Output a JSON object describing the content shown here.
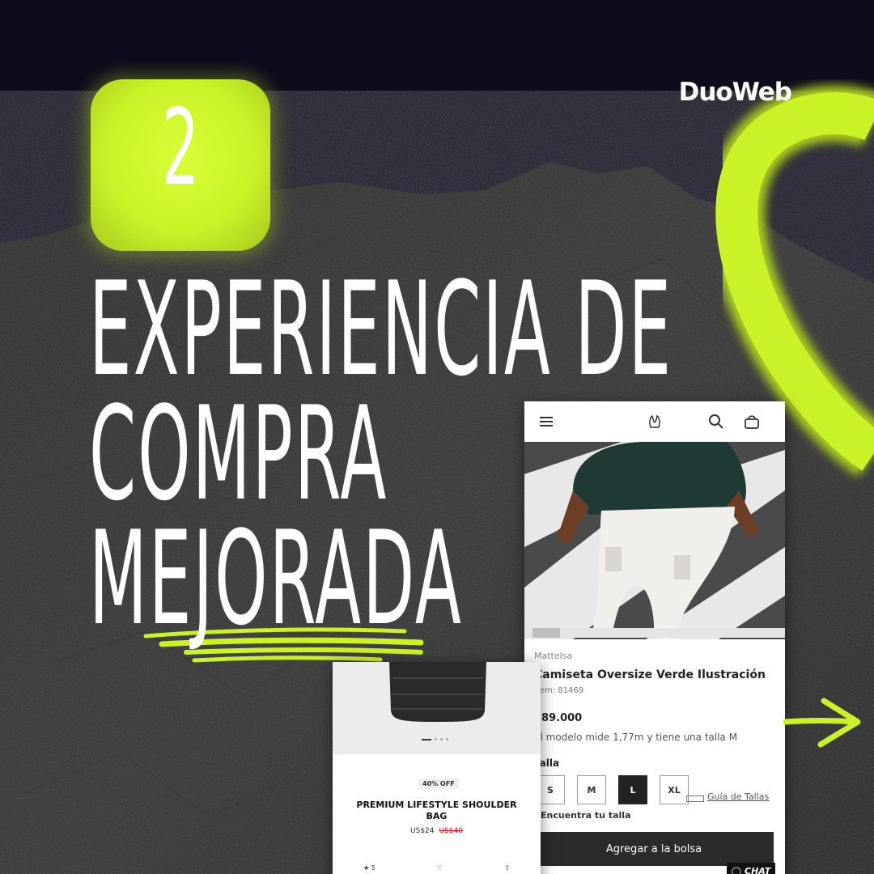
{
  "brand": "DuoWeb",
  "badge_number": "2",
  "headline": {
    "line1": "EXPERIENCIA DE",
    "line2": "COMPRA",
    "line3": "MEJORADA"
  },
  "colors": {
    "background": "#0d0b1c",
    "accent": "#c9f227",
    "text": "#ffffff"
  },
  "product_page": {
    "icons": [
      "menu-icon",
      "logo-icon",
      "search-icon",
      "cart-icon"
    ],
    "vendor": "Mattelsa",
    "name": "Camiseta Oversize Verde Ilustración",
    "item": "Item: 81469",
    "price": "$89.000",
    "model_note": "El modelo mide 1,77m y tiene una talla M",
    "size_label": "Talla",
    "sizes": [
      "S",
      "M",
      "L",
      "XL"
    ],
    "selected_size": "L",
    "size_guide": "Guía de Tallas",
    "find_size": "Encuentra tu talla",
    "add_to_bag": "Agregar a la bolsa",
    "chat": "CHAT"
  },
  "bag_card": {
    "discount": "40% OFF",
    "title": "PREMIUM LIFESTYLE SHOULDER BAG",
    "price": "US$24",
    "old_price": "US$40",
    "rating": "★ 5"
  }
}
